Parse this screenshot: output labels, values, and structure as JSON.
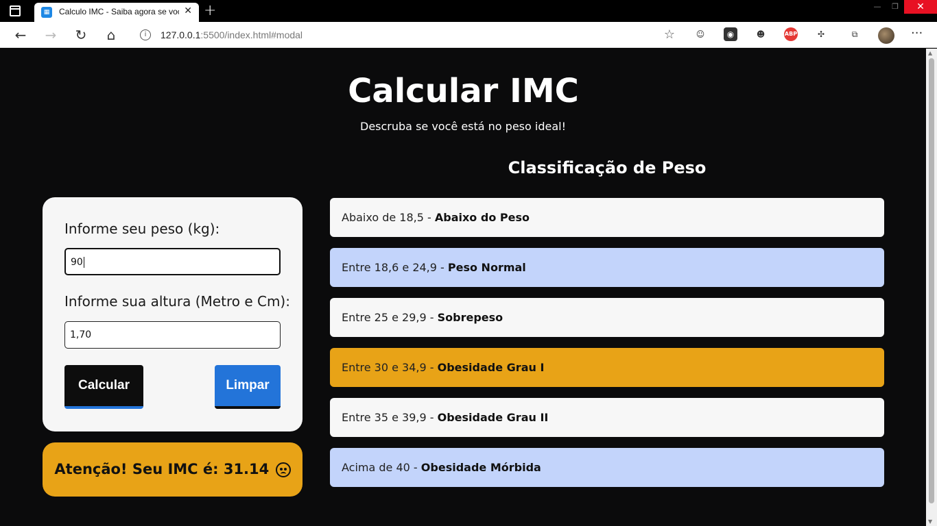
{
  "browser": {
    "tab_title": "Calculo IMC - Saiba agora se você",
    "tab_close": "✕",
    "new_tab": "+",
    "url_host": "127.0.0.1",
    "url_path": ":5500/index.html#modal",
    "icons": [
      "sidebar-toggle-icon",
      "back-arrow-icon",
      "forward-arrow-icon",
      "reload-icon",
      "home-icon",
      "info-icon",
      "add-favorite-icon",
      "extension-icon",
      "adblock-icon",
      "puzzle-icon",
      "collections-icon",
      "profile-avatar",
      "more-menu-icon"
    ]
  },
  "page": {
    "title": "Calcular IMC",
    "subtitle": "Descruba se você está no peso ideal!"
  },
  "form": {
    "peso_label": "Informe seu peso (kg):",
    "peso_value": "90",
    "altura_label": "Informe sua altura (Metro e Cm):",
    "altura_value": "1,70",
    "calc_label": "Calcular",
    "clear_label": "Limpar"
  },
  "result": {
    "text": "Atenção! Seu IMC é: 31.14"
  },
  "classification": {
    "title": "Classificação de Peso",
    "items": [
      {
        "range": "Abaixo de 18,5 - ",
        "name": "Abaixo do Peso",
        "color": "#f7f7f7"
      },
      {
        "range": "Entre 18,6 e 24,9 - ",
        "name": "Peso Normal",
        "color": "#c3d4fb"
      },
      {
        "range": "Entre 25 e 29,9 - ",
        "name": "Sobrepeso",
        "color": "#f7f7f7"
      },
      {
        "range": "Entre 30 e 34,9 - ",
        "name": "Obesidade Grau I",
        "color": "#e8a317"
      },
      {
        "range": "Entre 35 e 39,9 - ",
        "name": "Obesidade Grau II",
        "color": "#f7f7f7"
      },
      {
        "range": "Acima de 40 - ",
        "name": "Obesidade Mórbida",
        "color": "#c3d4fb"
      }
    ]
  },
  "colors": {
    "background": "#0b0b0c",
    "card": "#f6f6f6",
    "accent_blue": "#2374d9",
    "warning_orange": "#e8a317"
  }
}
